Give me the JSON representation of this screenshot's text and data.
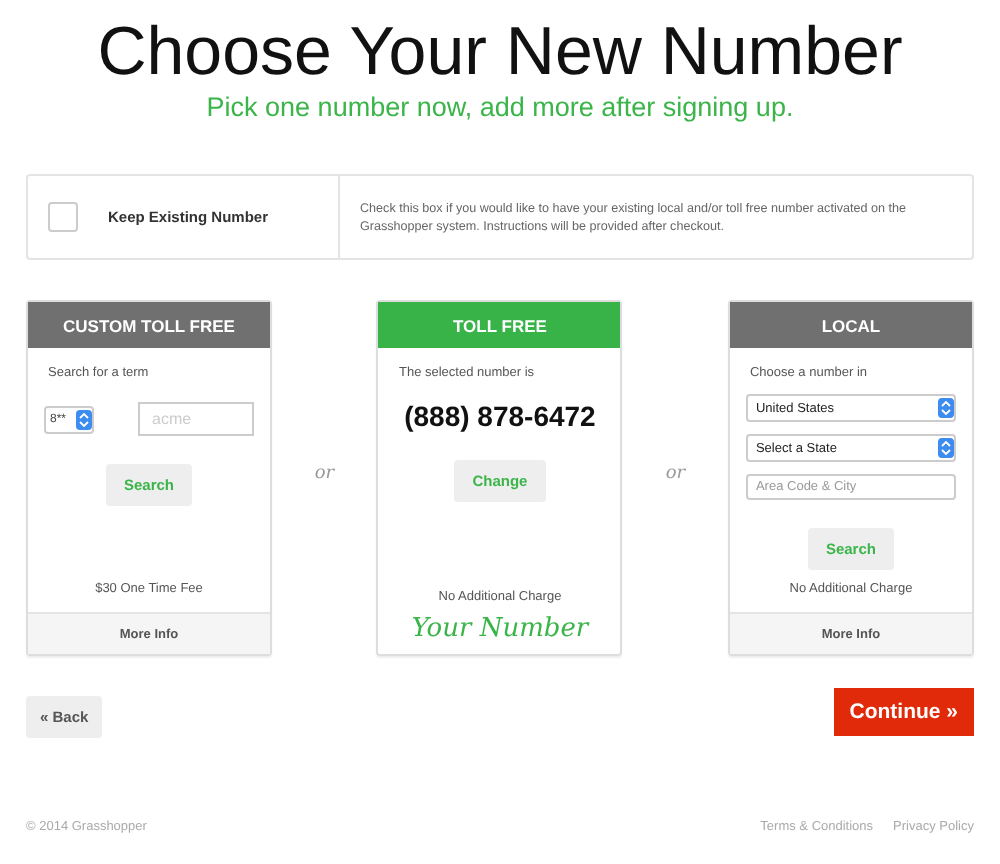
{
  "title": "Choose Your New Number",
  "subtitle": "Pick one number now, add more after signing up.",
  "keep_existing": {
    "checked": false,
    "label": "Keep Existing Number",
    "description": "Check this box if you would like to have your existing local and/or toll free number activated on the Grasshopper system. Instructions will be provided after checkout."
  },
  "cards": [
    {
      "kind": "custom",
      "selected": false,
      "header": "CUSTOM TOLL FREE",
      "prompt": "Search for a term",
      "prefix_select": "8**",
      "term_placeholder": "acme",
      "button": "Search",
      "fee": "$30 One Time Fee",
      "more": "More Info"
    },
    {
      "kind": "selected",
      "selected": true,
      "header": "TOLL FREE",
      "prompt": "The selected number is",
      "number": "(888) 878-6472",
      "button": "Change",
      "fee": "No Additional Charge",
      "signature": "Your Number"
    },
    {
      "kind": "local",
      "selected": false,
      "header": "LOCAL",
      "prompt": "Choose a number in",
      "selects": [
        "United States",
        "Select a State"
      ],
      "city_placeholder": "Area Code & City",
      "button": "Search",
      "fee": "No Additional Charge",
      "more": "More Info"
    }
  ],
  "separators": [
    "or",
    "or"
  ],
  "back_button": "« Back",
  "continue_button": "Continue »",
  "footer": {
    "copyright": "© 2014 Grasshopper",
    "links": [
      "Terms & Conditions",
      "Privacy Policy"
    ]
  }
}
